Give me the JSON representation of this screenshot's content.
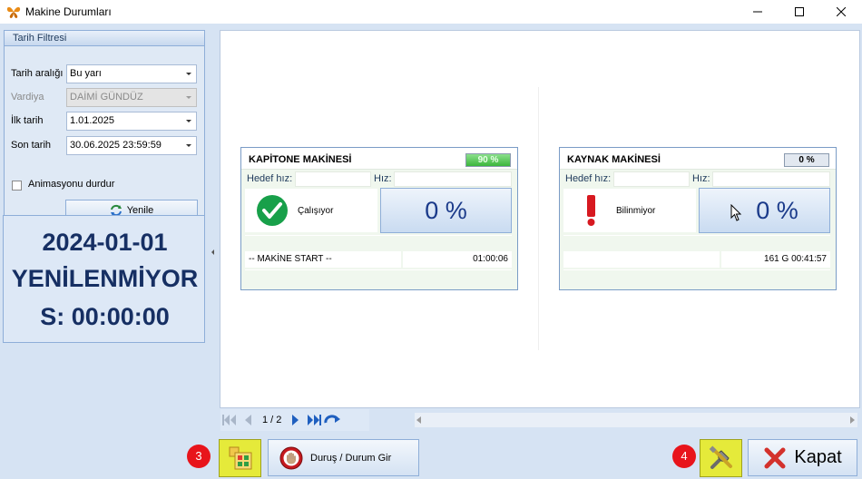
{
  "window": {
    "title": "Makine Durumları"
  },
  "filter": {
    "group_title": "Tarih Filtresi",
    "date_range_label": "Tarih aralığı",
    "date_range_value": "Bu yarı",
    "shift_label": "Vardiya",
    "shift_value": "DAİMİ GÜNDÜZ",
    "start_label": "İlk tarih",
    "start_value": "1.01.2025",
    "end_label": "Son tarih",
    "end_value": "30.06.2025 23:59:59",
    "animation_label": "Animasyonu durdur",
    "refresh_label": "Yenile"
  },
  "info": {
    "line1": "2024-01-01",
    "line2": "YENİLENMİYOR",
    "line3": "S: 00:00:00"
  },
  "machines": [
    {
      "name": "KAPİTONE MAKİNESİ",
      "badge": "90 %",
      "badge_level": 0.9,
      "target_speed_label": "Hedef hız:",
      "speed_label": "Hız:",
      "status": "Çalışıyor",
      "status_icon": "check-icon",
      "percent": "0 %",
      "event": "-- MAKİNE START --",
      "duration": "01:00:06"
    },
    {
      "name": "KAYNAK MAKİNESİ",
      "badge": "0 %",
      "badge_level": 0,
      "target_speed_label": "Hedef hız:",
      "speed_label": "Hız:",
      "status": "Bilinmiyor",
      "status_icon": "exclamation-icon",
      "percent": "0 %",
      "event": "",
      "duration": "161 G 00:41:57"
    }
  ],
  "pager": {
    "label": "1 / 2"
  },
  "toolbar": {
    "badge_left": "3",
    "stop_label": "Duruş / Durum Gir",
    "badge_right": "4",
    "close_label": "Kapat"
  },
  "colors": {
    "accent": "#162f63",
    "badge_red": "#e8141b",
    "highlight_yellow": "#e5ea3a",
    "ok_green": "#18a04a",
    "warn_red": "#d71920"
  }
}
